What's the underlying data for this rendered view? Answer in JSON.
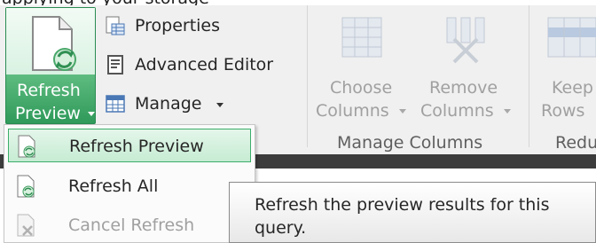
{
  "header": {
    "cropped_text": "applying to your storage"
  },
  "ribbon": {
    "refresh_button": {
      "label_line1": "Refresh",
      "label_line2": "Preview",
      "icon": "refresh-document-icon",
      "color": "#2f9a5a"
    },
    "small_buttons": [
      {
        "label": "Properties",
        "icon": "properties-icon"
      },
      {
        "label": "Advanced Editor",
        "icon": "advanced-editor-icon"
      },
      {
        "label": "Manage",
        "icon": "manage-table-icon",
        "has_dropdown": true
      }
    ],
    "manage_columns": {
      "choose_columns": {
        "line1": "Choose",
        "line2": "Columns"
      },
      "remove_columns": {
        "line1": "Remove",
        "line2": "Columns"
      },
      "group_label": "Manage Columns"
    },
    "reduce_rows": {
      "keep_rows": {
        "line1": "Keep",
        "line2": "Rows"
      },
      "group_label": "Redu"
    }
  },
  "menu": {
    "items": [
      {
        "label": "Refresh Preview",
        "icon": "refresh-preview-icon",
        "selected": true,
        "enabled": true
      },
      {
        "label": "Refresh All",
        "icon": "refresh-all-icon",
        "selected": false,
        "enabled": true
      },
      {
        "label": "Cancel Refresh",
        "icon": "cancel-refresh-icon",
        "selected": false,
        "enabled": false
      }
    ]
  },
  "tooltip": {
    "text": "Refresh the preview results for this query."
  }
}
